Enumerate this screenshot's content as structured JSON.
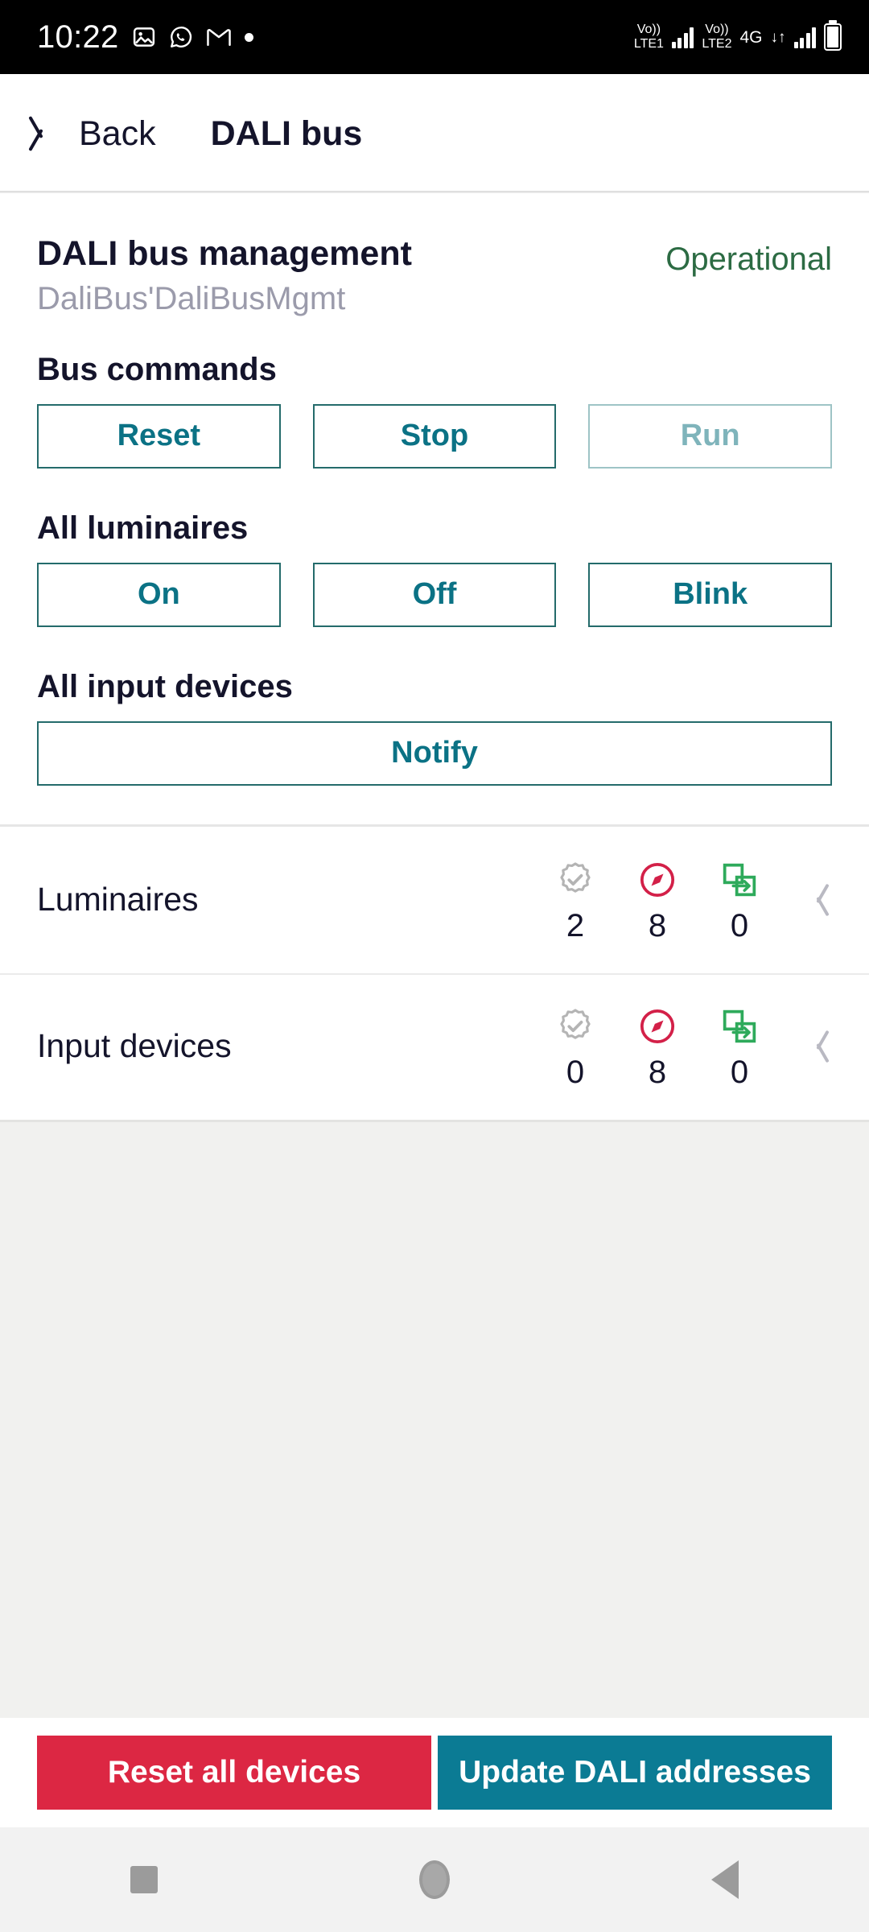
{
  "statusbar": {
    "clock": "10:22",
    "icons": [
      "photos-icon",
      "whatsapp-icon",
      "gmail-icon",
      "notification-dot-icon"
    ],
    "volte1_top": "Vo))",
    "volte1_bottom": "LTE1",
    "volte2_top": "Vo))",
    "volte2_bottom": "LTE2",
    "network": "4G",
    "data_arrows": "↓↑",
    "battery": "battery-icon"
  },
  "appbar": {
    "back_icon": "chevron-left-icon",
    "back_label": "Back",
    "title": "DALI bus"
  },
  "header": {
    "title": "DALI bus management",
    "subtitle": "DaliBus'DaliBusMgmt",
    "status": "Operational",
    "status_color": "#2c6b43"
  },
  "sections": [
    {
      "id": "bus-commands",
      "title": "Bus commands",
      "buttons": [
        {
          "label": "Reset",
          "enabled": true
        },
        {
          "label": "Stop",
          "enabled": true
        },
        {
          "label": "Run",
          "enabled": false
        }
      ]
    },
    {
      "id": "all-luminaires",
      "title": "All luminaires",
      "buttons": [
        {
          "label": "On",
          "enabled": true
        },
        {
          "label": "Off",
          "enabled": true
        },
        {
          "label": "Blink",
          "enabled": true
        }
      ]
    },
    {
      "id": "all-input-devices",
      "title": "All input devices",
      "buttons": [
        {
          "label": "Notify",
          "enabled": true,
          "wide": true
        }
      ]
    }
  ],
  "device_rows": [
    {
      "label": "Luminaires",
      "stats": [
        {
          "icon": "gear-check-icon",
          "value": "2",
          "color": "#b0b0b0"
        },
        {
          "icon": "compass-icon",
          "value": "8",
          "color": "#d32048"
        },
        {
          "icon": "copy-arrow-icon",
          "value": "0",
          "color": "#2eaa5b"
        }
      ],
      "chevron": "chevron-right-icon"
    },
    {
      "label": "Input devices",
      "stats": [
        {
          "icon": "gear-check-icon",
          "value": "0",
          "color": "#b0b0b0"
        },
        {
          "icon": "compass-icon",
          "value": "8",
          "color": "#d32048"
        },
        {
          "icon": "copy-arrow-icon",
          "value": "0",
          "color": "#2eaa5b"
        }
      ],
      "chevron": "chevron-right-icon"
    }
  ],
  "actions": [
    {
      "label": "Reset all devices",
      "style": "danger",
      "color": "#dc2743"
    },
    {
      "label": "Update DALI addresses",
      "style": "primary",
      "color": "#0b7b94"
    }
  ],
  "navbar": {
    "recents": "square-icon",
    "home": "circle-icon",
    "back": "triangle-left-icon"
  },
  "theme": {
    "accent_teal": "#0b7285",
    "border_teal": "#246b6b",
    "disabled_teal": "#7fb4bb"
  }
}
